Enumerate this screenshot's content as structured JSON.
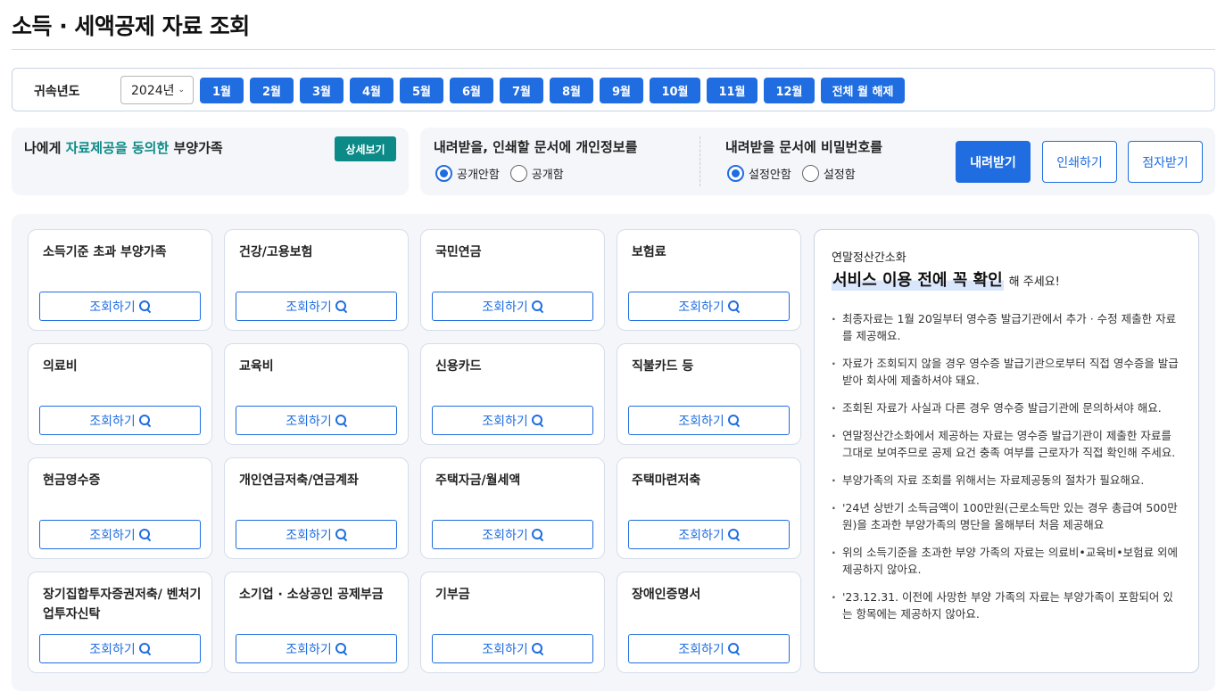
{
  "page": {
    "title": "소득 · 세액공제 자료 조회"
  },
  "year_bar": {
    "label": "귀속년도",
    "selected_year": "2024년",
    "months": [
      "1월",
      "2월",
      "3월",
      "4월",
      "5월",
      "6월",
      "7월",
      "8월",
      "9월",
      "10월",
      "11월",
      "12월"
    ],
    "clear_label": "전체 월 해제"
  },
  "dependents": {
    "prefix": "나에게 ",
    "highlight": "자료제공을 동의한",
    "suffix": " 부양가족",
    "detail_label": "상세보기"
  },
  "options": {
    "privacy": {
      "title": "내려받을, 인쇄할 문서에 개인정보를",
      "options": [
        "공개안함",
        "공개함"
      ],
      "selected": "공개안함"
    },
    "password": {
      "title": "내려받을 문서에 비밀번호를",
      "options": [
        "설정안함",
        "설정함"
      ],
      "selected": "설정안함"
    },
    "download_label": "내려받기",
    "print_label": "인쇄하기",
    "braille_label": "점자받기"
  },
  "cards": {
    "button_label": "조회하기",
    "items": [
      "소득기준 초과 부양가족",
      "건강/고용보험",
      "국민연금",
      "보험료",
      "의료비",
      "교육비",
      "신용카드",
      "직불카드 등",
      "현금영수증",
      "개인연금저축/연금계좌",
      "주택자금/월세액",
      "주택마련저축",
      "장기집합투자증권저축/ 벤처기업투자신탁",
      "소기업 · 소상공인 공제부금",
      "기부금",
      "장애인증명서"
    ]
  },
  "info": {
    "subtitle": "연말정산간소화",
    "headline": "서비스 이용 전에 꼭 확인",
    "headline_suffix": "해 주세요!",
    "items": [
      "최종자료는 1월 20일부터 영수증 발급기관에서 추가 · 수정 제출한 자료를 제공해요.",
      "자료가 조회되지 않을 경우 영수증 발급기관으로부터 직접 영수증을 발급받아 회사에 제출하셔야 돼요.",
      "조회된 자료가 사실과 다른 경우 영수증 발급기관에 문의하셔야 해요.",
      "연말정산간소화에서 제공하는 자료는 영수증 발급기관이 제출한 자료를 그대로 보여주므로 공제 요건 충족 여부를 근로자가 직접 확인해 주세요.",
      "부양가족의 자료 조회를 위해서는 자료제공동의 절차가 필요해요.",
      "'24년 상반기 소득금액이 100만원(근로소득만 있는 경우 총급여 500만원)을 초과한 부양가족의 명단을 올해부터 처음 제공해요",
      "위의 소득기준을 초과한 부양 가족의 자료는 의료비•교육비•보험료 외에 제공하지 않아요.",
      "'23.12.31. 이전에 사망한 부양 가족의 자료는 부양가족이 포함되어 있는 항목에는 제공하지 않아요."
    ]
  }
}
